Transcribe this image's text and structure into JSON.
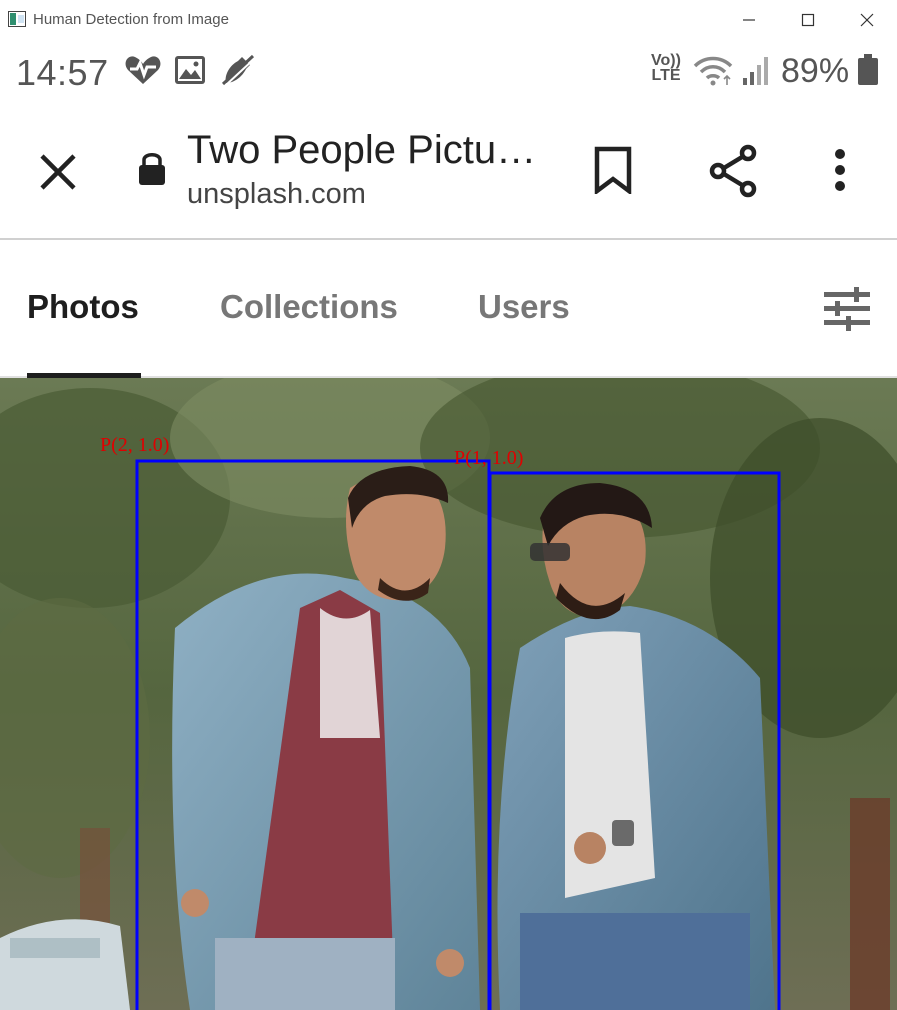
{
  "window": {
    "title": "Human Detection from Image"
  },
  "status_bar": {
    "time": "14:57",
    "network": "Vo)) LTE",
    "battery": "89%",
    "icons": [
      "heart-pulse-icon",
      "image-icon",
      "phone-off-icon",
      "wifi-icon",
      "signal-icon",
      "battery-icon"
    ]
  },
  "browser": {
    "page_title": "Two People Pictu…",
    "domain": "unsplash.com",
    "icons": [
      "close-icon",
      "lock-icon",
      "bookmark-icon",
      "share-icon",
      "more-vert-icon"
    ]
  },
  "tabs": [
    {
      "label": "Photos",
      "active": true
    },
    {
      "label": "Collections",
      "active": false
    },
    {
      "label": "Users",
      "active": false
    }
  ],
  "detections": [
    {
      "label": "P(2, 1.0)"
    },
    {
      "label": "P(1, 1.0)"
    }
  ],
  "colors": {
    "box": "#0000ff",
    "label": "#e00000"
  }
}
